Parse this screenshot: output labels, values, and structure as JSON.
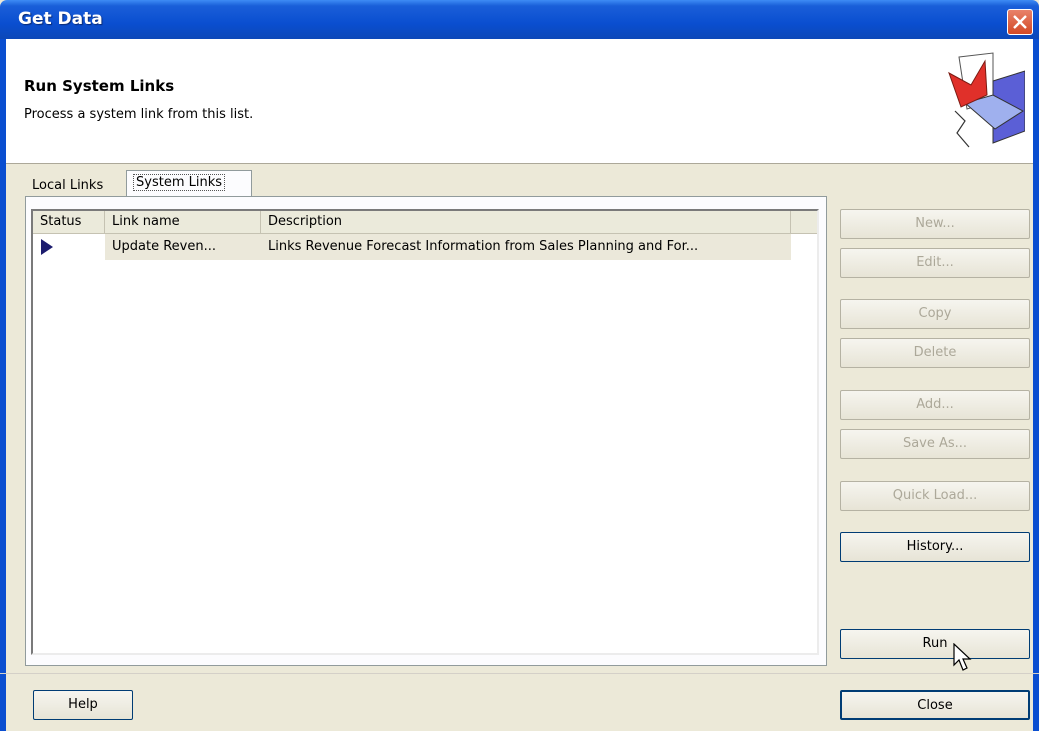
{
  "window": {
    "title": "Get Data"
  },
  "header": {
    "title": "Run System Links",
    "subtitle": "Process a system link from this list."
  },
  "tabs": [
    {
      "label": "Local Links",
      "active": false
    },
    {
      "label": "System Links",
      "active": true
    }
  ],
  "list": {
    "columns": [
      "Status",
      "Link name",
      "Description"
    ],
    "rows": [
      {
        "status_icon": "triangle-right-icon",
        "link_name": "Update Reven...",
        "description": "Links Revenue Forecast Information from Sales Planning and For..."
      }
    ]
  },
  "buttons": {
    "new": "New...",
    "edit": "Edit...",
    "copy": "Copy",
    "delete": "Delete",
    "add": "Add...",
    "save_as": "Save As...",
    "quick_load": "Quick Load...",
    "history": "History...",
    "run": "Run",
    "help": "Help",
    "close": "Close"
  },
  "colors": {
    "titlebar": "#0a4ed0",
    "face": "#ece9d8"
  }
}
